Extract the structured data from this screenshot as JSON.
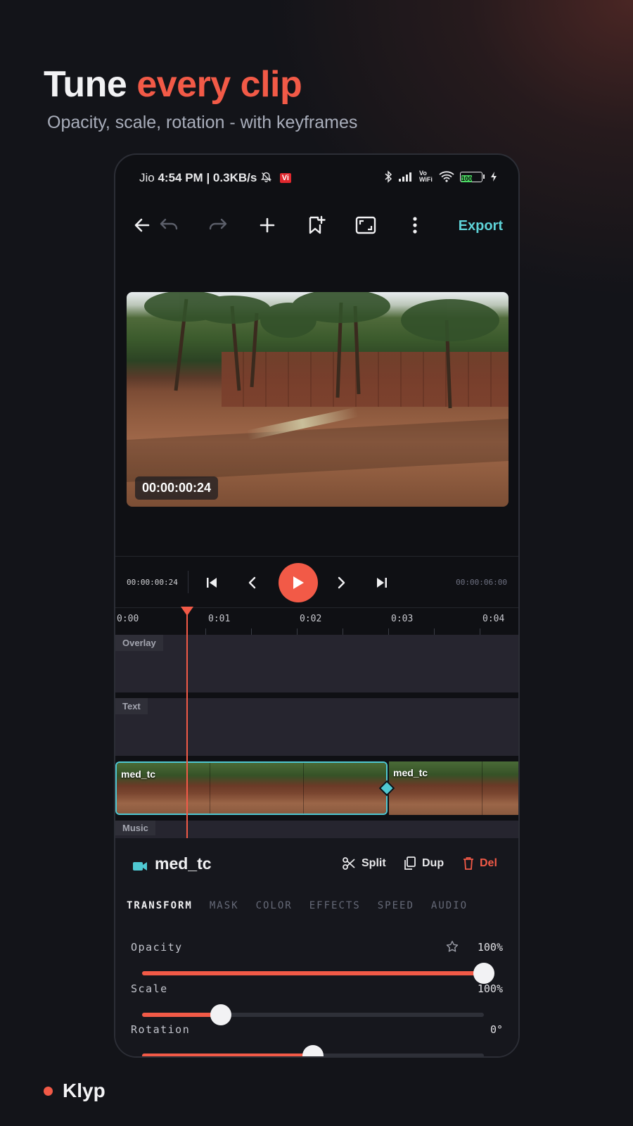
{
  "headline": {
    "part1": "Tune",
    "part2": "every clip"
  },
  "subheadline": "Opacity, scale, rotation - with keyframes",
  "status_bar": {
    "carrier": "Jio",
    "time": "4:54 PM",
    "speed": "| 0.3KB/s",
    "badge": "Vi",
    "vowifi": "Vo WiFi",
    "battery": "100"
  },
  "toolbar": {
    "export_label": "Export"
  },
  "preview": {
    "timecode": "00:00:00:24"
  },
  "transport": {
    "current": "00:00:00:24",
    "total": "00:00:06:00"
  },
  "ruler": {
    "labels": [
      "0:00",
      "0:01",
      "0:02",
      "0:03",
      "0:04"
    ]
  },
  "tracks": {
    "overlay": "Overlay",
    "text": "Text",
    "music": "Music"
  },
  "clips": [
    {
      "name": "med_tc"
    },
    {
      "name": "med_tc"
    }
  ],
  "panel": {
    "clip_name": "med_tc",
    "split_label": "Split",
    "dup_label": "Dup",
    "del_label": "Del",
    "tabs": [
      "TRANSFORM",
      "MASK",
      "COLOR",
      "EFFECTS",
      "SPEED",
      "AUDIO"
    ],
    "properties": [
      {
        "label": "Opacity",
        "value": "100%",
        "level": 1.0
      },
      {
        "label": "Scale",
        "value": "100%",
        "level": 0.23
      },
      {
        "label": "Rotation",
        "value": "0°",
        "level": 0.5
      }
    ]
  },
  "brand": {
    "name": "Klyp"
  },
  "colors": {
    "accent": "#f25a47",
    "teal": "#5ed3d8",
    "background": "#131419"
  }
}
